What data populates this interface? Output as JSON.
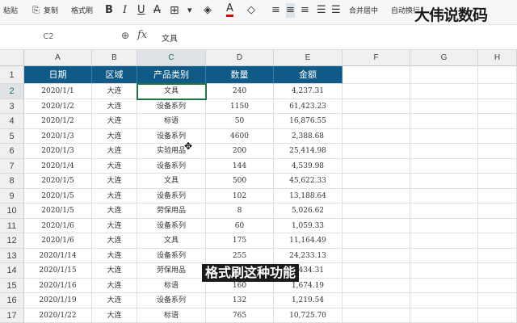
{
  "toolbar": {
    "paste": "粘贴",
    "copy": "复制",
    "format_painter": "格式刷",
    "bold": "B",
    "italic": "I",
    "underline": "U",
    "merge_center": "合并居中",
    "auto_wrap": "自动换行"
  },
  "formula_bar": {
    "name_box": "C2",
    "fx": "fx",
    "value": "文具"
  },
  "grid": {
    "columns": [
      "A",
      "B",
      "C",
      "D",
      "E",
      "F",
      "G",
      "H"
    ],
    "rows": [
      "1",
      "2",
      "3",
      "4",
      "5",
      "6",
      "7",
      "8",
      "9",
      "10",
      "11",
      "12",
      "13",
      "14",
      "15",
      "16",
      "17"
    ],
    "headers": [
      "日期",
      "区域",
      "产品类别",
      "数量",
      "金额"
    ],
    "data": [
      [
        "2020/1/1",
        "大连",
        "文具",
        "240",
        "4,237.31"
      ],
      [
        "2020/1/2",
        "大连",
        "设备系列",
        "1150",
        "61,423.23"
      ],
      [
        "2020/1/2",
        "大连",
        "标语",
        "50",
        "16,876.55"
      ],
      [
        "2020/1/3",
        "大连",
        "设备系列",
        "4600",
        "2,388.68"
      ],
      [
        "2020/1/3",
        "大连",
        "实验用品",
        "200",
        "25,414.98"
      ],
      [
        "2020/1/4",
        "大连",
        "设备系列",
        "144",
        "4,539.98"
      ],
      [
        "2020/1/5",
        "大连",
        "文具",
        "500",
        "45,622.33"
      ],
      [
        "2020/1/5",
        "大连",
        "设备系列",
        "102",
        "13,188.64"
      ],
      [
        "2020/1/5",
        "大连",
        "劳保用品",
        "8",
        "5,026.62"
      ],
      [
        "2020/1/6",
        "大连",
        "设备系列",
        "60",
        "1,059.33"
      ],
      [
        "2020/1/6",
        "大连",
        "文具",
        "175",
        "11,164.49"
      ],
      [
        "2020/1/14",
        "大连",
        "设备系列",
        "255",
        "24,233.13"
      ],
      [
        "2020/1/15",
        "大连",
        "劳保用品",
        "78",
        "6,434.31"
      ],
      [
        "2020/1/16",
        "大连",
        "标语",
        "160",
        "1,674.19"
      ],
      [
        "2020/1/19",
        "大连",
        "设备系列",
        "132",
        "1,219.54"
      ],
      [
        "2020/1/22",
        "大连",
        "标语",
        "765",
        "10,725.70"
      ]
    ]
  },
  "overlay": {
    "watermark": "大伟说数码",
    "subtitle": "格式刷这种功能"
  },
  "colors": {
    "header_fill": "#0f5a86",
    "selection": "#217346"
  }
}
